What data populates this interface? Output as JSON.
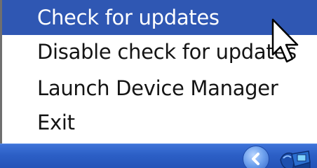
{
  "menu": {
    "items": [
      {
        "label": "Check for updates",
        "highlighted": true
      },
      {
        "label": "Disable check for updates"
      },
      {
        "label": "Launch Device Manager"
      },
      {
        "label": "Exit"
      }
    ]
  },
  "taskbar": {
    "tray_icons": [
      "chevron-left-icon",
      "device-manager-tray-icon"
    ]
  },
  "colors": {
    "highlight": "#2f57b3",
    "taskbar": "#2c5fc6",
    "menu_text": "#141414"
  }
}
